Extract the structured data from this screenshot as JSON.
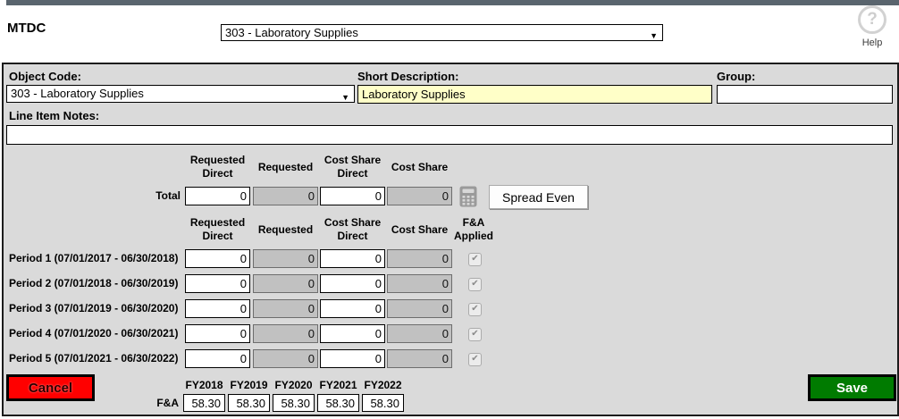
{
  "header": {
    "title": "MTDC",
    "category_dropdown": {
      "value": "303 - Laboratory Supplies"
    },
    "help_label": "Help"
  },
  "icons": {
    "dropdown_arrow": "▼",
    "help_question": "?",
    "checkmark": "✔"
  },
  "form": {
    "object_code": {
      "label": "Object Code:",
      "value": "303 - Laboratory Supplies"
    },
    "short_description": {
      "label": "Short Description:",
      "value": "Laboratory Supplies"
    },
    "group": {
      "label": "Group:",
      "value": ""
    },
    "line_item_notes": {
      "label": "Line Item Notes:",
      "value": ""
    }
  },
  "totals": {
    "columns": [
      "Requested\nDirect",
      "Requested",
      "Cost Share\nDirect",
      "Cost Share"
    ],
    "fa_applied_column": "F&A\nApplied",
    "total_label": "Total",
    "values": {
      "requested_direct": "0",
      "requested": "0",
      "cost_share_direct": "0",
      "cost_share": "0"
    },
    "spread_even_label": "Spread Even"
  },
  "periods": [
    {
      "label": "Period 1 (07/01/2017 - 06/30/2018)",
      "requested_direct": "0",
      "requested": "0",
      "cost_share_direct": "0",
      "cost_share": "0",
      "fa_applied": true
    },
    {
      "label": "Period 2 (07/01/2018 - 06/30/2019)",
      "requested_direct": "0",
      "requested": "0",
      "cost_share_direct": "0",
      "cost_share": "0",
      "fa_applied": true
    },
    {
      "label": "Period 3 (07/01/2019 - 06/30/2020)",
      "requested_direct": "0",
      "requested": "0",
      "cost_share_direct": "0",
      "cost_share": "0",
      "fa_applied": true
    },
    {
      "label": "Period 4 (07/01/2020 - 06/30/2021)",
      "requested_direct": "0",
      "requested": "0",
      "cost_share_direct": "0",
      "cost_share": "0",
      "fa_applied": true
    },
    {
      "label": "Period 5 (07/01/2021 - 06/30/2022)",
      "requested_direct": "0",
      "requested": "0",
      "cost_share_direct": "0",
      "cost_share": "0",
      "fa_applied": true
    }
  ],
  "footer": {
    "cancel_label": "Cancel",
    "save_label": "Save",
    "fa_label": "F&A",
    "fy_columns": [
      "FY2018",
      "FY2019",
      "FY2020",
      "FY2021",
      "FY2022"
    ],
    "fa_values": [
      "58.30",
      "58.30",
      "58.30",
      "58.30",
      "58.30"
    ]
  },
  "colors": {
    "topbar": "#5a656e",
    "form_background": "#dadada",
    "highlight_yellow": "#ffffc8",
    "disabled_gray": "#c1c1c1",
    "cancel_red": "#ff0000",
    "save_green": "#007b00"
  }
}
